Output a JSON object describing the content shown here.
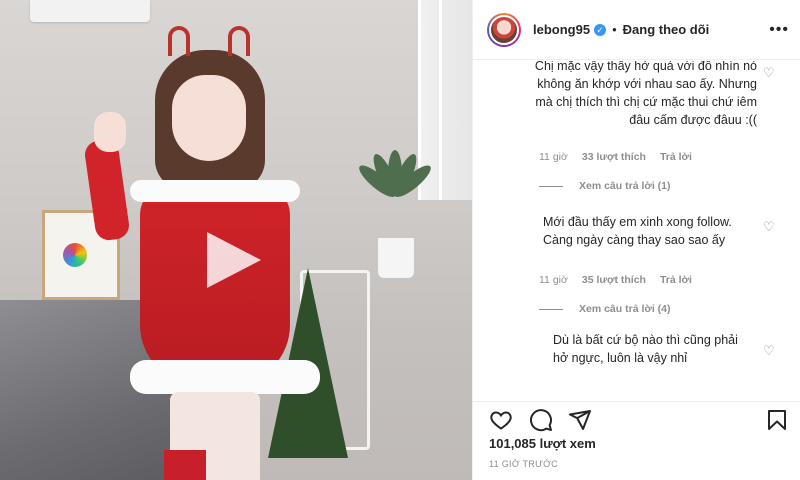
{
  "post": {
    "username": "lebong95",
    "separator": "•",
    "follow_status": "Đang theo dõi",
    "more_icon": "more-horizontal-icon",
    "verified_icon": "verified-badge-icon",
    "play_icon": "play-icon"
  },
  "comments": [
    {
      "text": "Chị mặc vậy thấy hở quá với đồ nhìn nó không ăn khớp với nhau sao ấy. Nhưng mà chị thích thì chị cứ mặc thui chứ iêm đâu cấm được đâuu :((",
      "time": "11 giờ",
      "likes": "33 lượt thích",
      "reply": "Trả lời",
      "view_replies": "Xem câu trả lời (1)"
    },
    {
      "text": "Mới đầu thấy em xinh xong follow. Càng ngày càng thay sao sao ấy",
      "time": "11 giờ",
      "likes": "35 lượt thích",
      "reply": "Trả lời",
      "view_replies": "Xem câu trả lời (4)"
    },
    {
      "text": "Dù là bất cứ bộ nào thì cũng phải hở ngực, luôn là vậy nhỉ"
    }
  ],
  "footer": {
    "views": "101,085 lượt xem",
    "posted": "11 GIỜ TRƯỚC"
  },
  "colors": {
    "text": "#262626",
    "muted": "#8e8e8e",
    "verified": "#3897f0",
    "border": "#efefef"
  }
}
